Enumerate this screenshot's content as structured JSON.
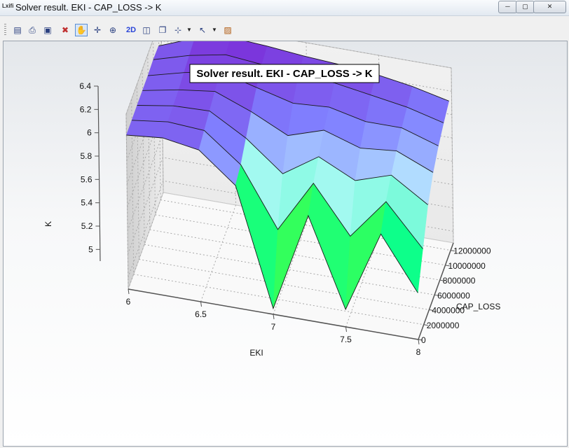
{
  "window": {
    "app_icon": "Lxifi",
    "title": "Solver result. EKI - CAP_LOSS -> K",
    "minimize_glyph": "─",
    "maximize_glyph": "▢",
    "close_glyph": "✕"
  },
  "toolbar": {
    "icons": [
      "chart-icon",
      "print-icon",
      "save-icon",
      "reset-icon",
      "pan-hand-icon",
      "crosshair-icon",
      "zoom-icon",
      "2d-button",
      "cube-icon",
      "box-icon",
      "axes-icon",
      "pointer-icon",
      "palette-icon"
    ],
    "text_2d": "2D"
  },
  "chart_data": {
    "type": "surface3d",
    "title": "Solver result. EKI - CAP_LOSS -> K",
    "xlabel": "EKI",
    "ylabel": "CAP_LOSS",
    "zlabel": "K",
    "xlim": [
      6,
      8
    ],
    "ylim": [
      0,
      13000000
    ],
    "zlim": [
      4.9,
      6.4
    ],
    "x_ticks": [
      "6",
      "6.5",
      "7",
      "7.5",
      "8"
    ],
    "y_ticks": [
      "0",
      "2000000",
      "4000000",
      "6000000",
      "8000000",
      "10000000",
      "12000000"
    ],
    "z_ticks": [
      "5",
      "5.2",
      "5.4",
      "5.6",
      "5.8",
      "6",
      "6.2",
      "6.4"
    ],
    "x": [
      6.0,
      6.25,
      6.5,
      6.75,
      7.0,
      7.25,
      7.5,
      7.75,
      8.0
    ],
    "y": [
      0,
      2000000,
      4000000,
      6000000,
      8000000,
      10000000,
      12000000
    ],
    "z": [
      [
        6.22,
        6.22,
        6.22,
        6.22,
        6.22,
        6.23,
        6.22
      ],
      [
        6.25,
        6.26,
        6.27,
        6.28,
        6.3,
        6.32,
        6.34
      ],
      [
        6.2,
        6.24,
        6.28,
        6.32,
        6.36,
        6.38,
        6.4
      ],
      [
        5.95,
        6.0,
        6.1,
        6.2,
        6.28,
        6.35,
        6.38
      ],
      [
        4.95,
        5.5,
        5.85,
        6.05,
        6.2,
        6.3,
        6.35
      ],
      [
        5.8,
        5.95,
        6.05,
        6.15,
        6.22,
        6.3,
        6.33
      ],
      [
        5.05,
        5.55,
        5.9,
        6.05,
        6.15,
        6.25,
        6.3
      ],
      [
        5.75,
        5.9,
        6.0,
        6.08,
        6.15,
        6.2,
        6.25
      ],
      [
        5.3,
        5.55,
        5.8,
        5.95,
        6.05,
        6.12,
        6.18
      ]
    ],
    "colorscale": [
      "#ff4400",
      "#ffff00",
      "#7fff00",
      "#00ff99",
      "#bff8ff",
      "#8080ff",
      "#7b2fd8"
    ],
    "grid": true,
    "legend": "none"
  }
}
